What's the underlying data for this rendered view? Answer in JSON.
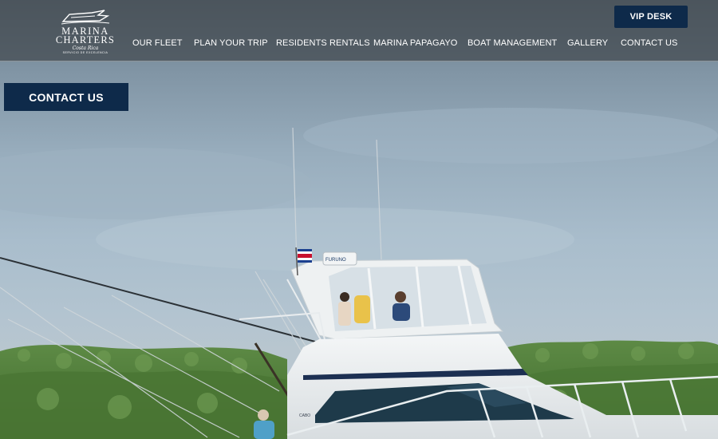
{
  "brand": {
    "line1": "MARINA",
    "line2": "CHARTERS",
    "script": "Costa Rica",
    "tagline": "SERVICIO DE EXCELENCIA"
  },
  "nav": {
    "items": [
      {
        "label": "OUR FLEET"
      },
      {
        "label": "PLAN YOUR TRIP"
      },
      {
        "label": "RESIDENTS RENTALS"
      },
      {
        "label": "MARINA PAPAGAYO"
      },
      {
        "label": "BOAT MANAGEMENT"
      },
      {
        "label": "GALLERY"
      },
      {
        "label": "CONTACT US"
      }
    ]
  },
  "header": {
    "vip_label": "VIP DESK"
  },
  "hero": {
    "cta_label": "CONTACT US",
    "boat_brand": "FURUNO",
    "boat_model": "CABO"
  },
  "colors": {
    "button_bg": "#0e2a4a",
    "header_bg": "#464e54",
    "sky": "#a9bdcc",
    "hills": "#4f7a3a"
  },
  "icons": {
    "logo": "yacht-logo-icon",
    "flag": "costa-rica-flag-icon"
  }
}
